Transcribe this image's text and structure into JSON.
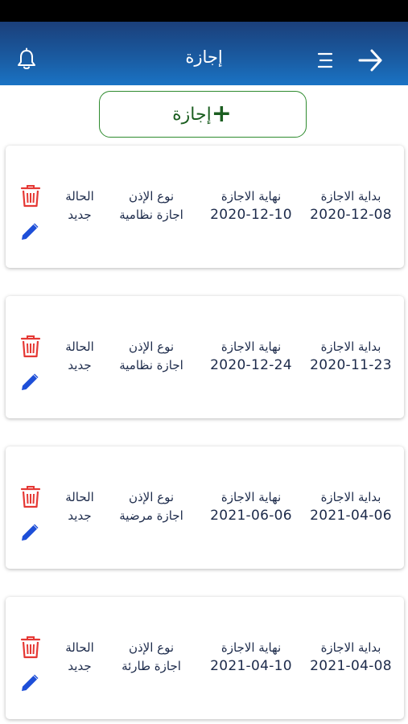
{
  "header": {
    "title": "إجازة",
    "icons": {
      "notification": "bell-icon",
      "menu": "menu-icon",
      "back": "arrow-right-icon"
    }
  },
  "add_button": {
    "label": "إجازة",
    "icon": "+"
  },
  "labels": {
    "start": "بداية الاجازة",
    "end": "نهاية الاجازة",
    "type": "نوع الإذن",
    "status": "الحالة"
  },
  "leaves": [
    {
      "start": "2020-12-08",
      "end": "2020-12-10",
      "type": "اجازة نظامية",
      "status": "جديد"
    },
    {
      "start": "2020-11-23",
      "end": "2020-12-24",
      "type": "اجازة نظامية",
      "status": "جديد"
    },
    {
      "start": "2021-04-06",
      "end": "2021-06-06",
      "type": "اجازة مرضية",
      "status": "جديد"
    },
    {
      "start": "2021-04-08",
      "end": "2021-04-10",
      "type": "اجازة طارئة",
      "status": "جديد"
    }
  ],
  "colors": {
    "app_bar_top": "#1b3f7a",
    "app_bar_bottom": "#1a73c4",
    "add_border": "#2e8b2e",
    "delete": "#e53935",
    "edit": "#1e4fd8",
    "text": "#1c2a4a"
  }
}
